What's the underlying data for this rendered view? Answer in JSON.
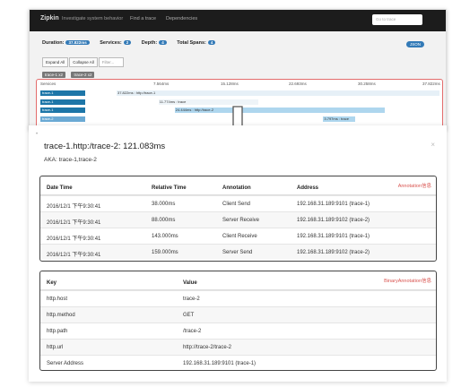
{
  "navbar": {
    "brand": "Zipkin",
    "tagline": "Investigate system behavior",
    "links": [
      "Find a trace",
      "Dependencies"
    ],
    "goto_placeholder": "Go to trace"
  },
  "stats": {
    "duration_label": "Duration:",
    "duration_value": "37.822ms",
    "services_label": "Services:",
    "services_value": "2",
    "depth_label": "Depth:",
    "depth_value": "4",
    "spans_label": "Total Spans:",
    "spans_value": "4",
    "json_label": "JSON"
  },
  "controls": {
    "expand": "Expand All",
    "collapse": "Collapse All",
    "filter": "Filter..."
  },
  "service_tags": [
    "trace-1 x2",
    "trace-2 x2"
  ],
  "timeline": {
    "services_header": "Services",
    "ticks": [
      "7.564ms",
      "15.128ms",
      "22.693ms",
      "30.258ms",
      "37.822ms"
    ],
    "rows": [
      {
        "service": "trace-1",
        "bar_label": "37.822ms : http:/trace-1",
        "start": 0.0,
        "width": 1.0
      },
      {
        "service": "trace-1",
        "bar_label": "11.774ms : trace",
        "start": 0.13,
        "width": 0.31
      },
      {
        "service": "trace-1",
        "bar_label": "24.444ms : http:/trace-2",
        "start": 0.18,
        "width": 0.65
      },
      {
        "service": "trace-2",
        "bar_label": "3.797ms : trace",
        "start": 0.64,
        "width": 0.1
      }
    ]
  },
  "detail": {
    "title": "trace-1.http:/trace-2: 121.083ms",
    "aka": "AKA: trace-1,trace-2",
    "close_glyph": "×",
    "left_mark": "•",
    "annotation_note": "Annotation信息",
    "annotation_columns": [
      "Date Time",
      "Relative Time",
      "Annotation",
      "Address"
    ],
    "annotations": [
      [
        "2016/12/1 下午9:30:41",
        "38.000ms",
        "Client Send",
        "192.168.31.189:9101 (trace-1)"
      ],
      [
        "2016/12/1 下午9:30:41",
        "88.000ms",
        "Server Receive",
        "192.168.31.189:9102 (trace-2)"
      ],
      [
        "2016/12/1 下午9:30:41",
        "143.000ms",
        "Client Receive",
        "192.168.31.189:9101 (trace-1)"
      ],
      [
        "2016/12/1 下午9:30:41",
        "159.000ms",
        "Server Send",
        "192.168.31.189:9102 (trace-2)"
      ]
    ],
    "binary_note": "BinaryAnnotation信息",
    "binary_columns": [
      "Key",
      "Value"
    ],
    "binary": [
      [
        "http.host",
        "trace-2"
      ],
      [
        "http.method",
        "GET"
      ],
      [
        "http.path",
        "/trace-2"
      ],
      [
        "http.url",
        "http://trace-2/trace-2"
      ],
      [
        "Server Address",
        "192.168.31.189:9101 (trace-1)"
      ]
    ]
  },
  "colors": {
    "accent": "#337ab7",
    "span_dark": "#1d76a8",
    "span_light": "#aed6ee",
    "highlight_border": "#e36c6c",
    "note_red": "#d9534f"
  }
}
